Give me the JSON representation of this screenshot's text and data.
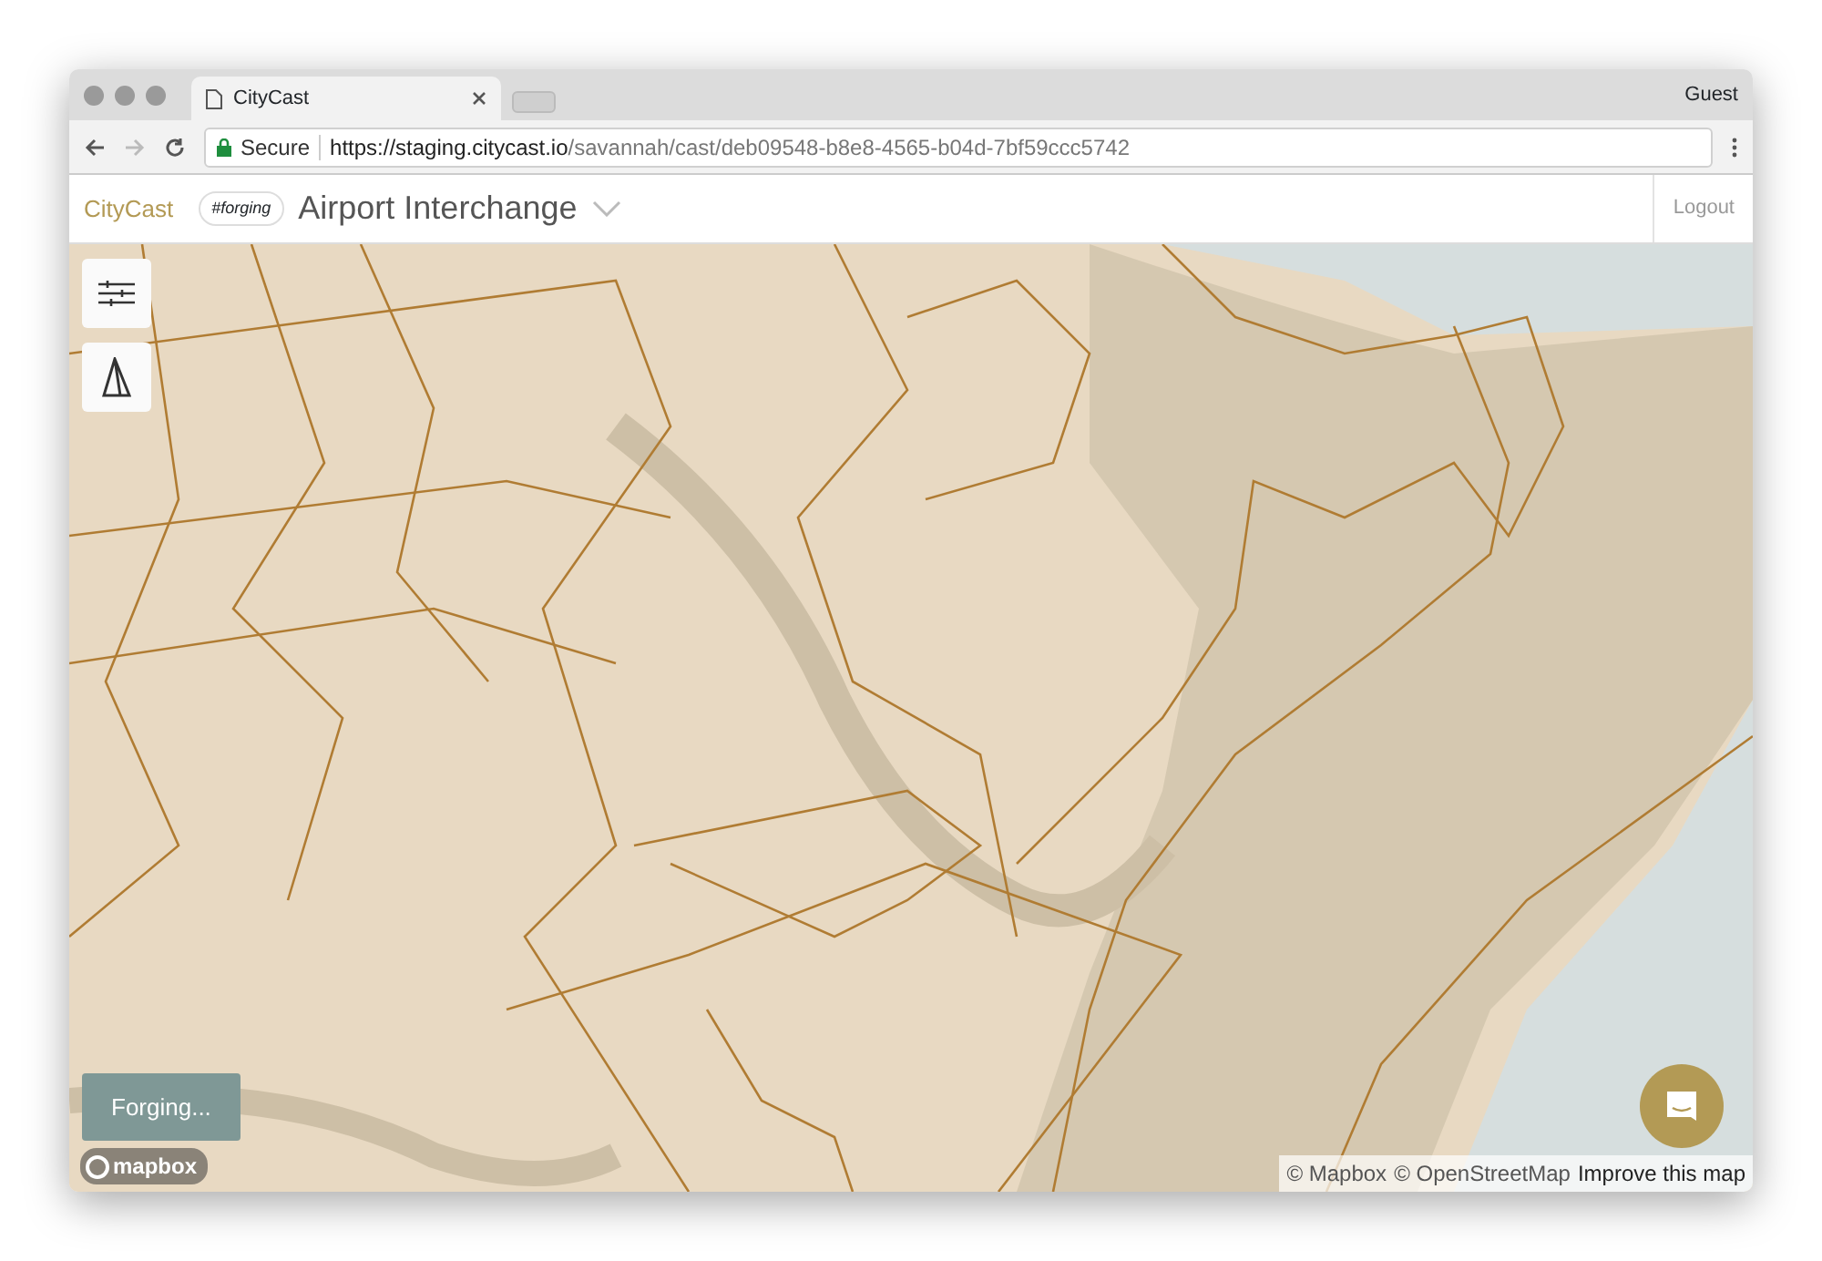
{
  "browser": {
    "tab_title": "CityCast",
    "profile": "Guest",
    "security": "Secure",
    "url_host": "https://staging.citycast.io",
    "url_path": "/savannah/cast/deb09548-b8e8-4565-b04d-7bf59ccc5742"
  },
  "header": {
    "brand": "CityCast",
    "tag": "#forging",
    "title": "Airport Interchange",
    "logout": "Logout"
  },
  "map": {
    "status": "Forging...",
    "logo": "mapbox",
    "attribution": [
      {
        "text": "© Mapbox",
        "kind": "credit"
      },
      {
        "text": "© OpenStreetMap",
        "kind": "credit"
      },
      {
        "text": "Improve this map",
        "kind": "link"
      }
    ]
  }
}
